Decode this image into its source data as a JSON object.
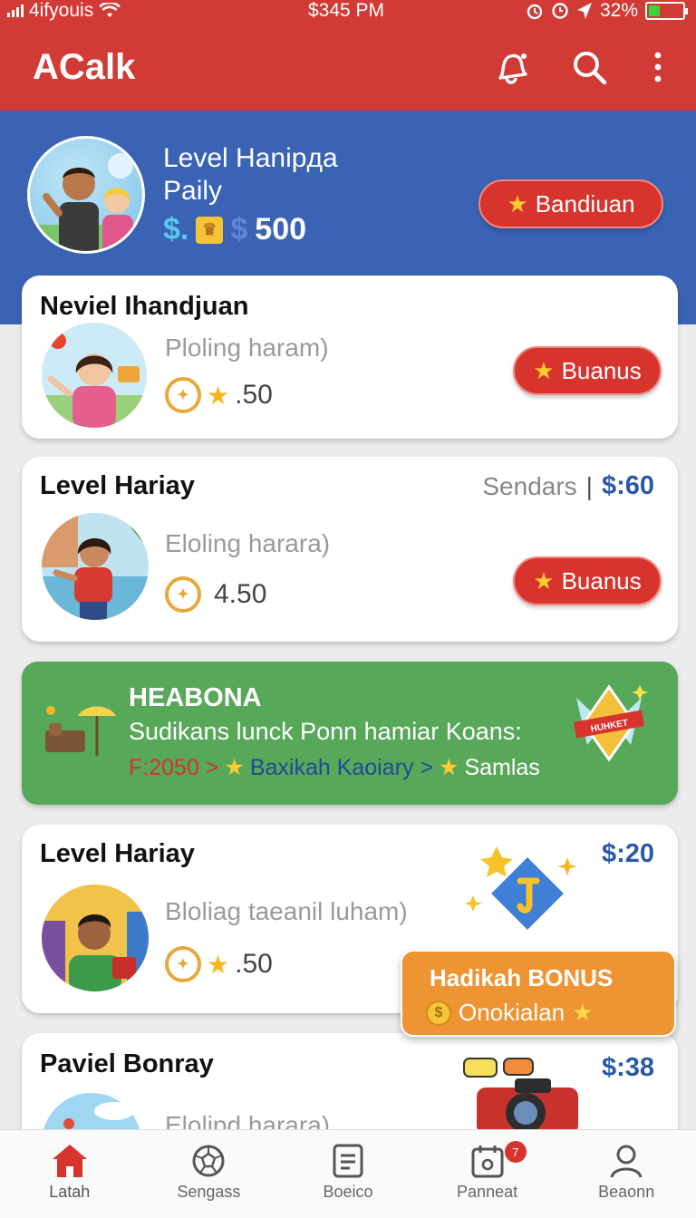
{
  "status_bar": {
    "carrier": "4ifyouis",
    "time": "$345 PM",
    "battery": "32%",
    "battery_level": 0.32
  },
  "app_bar": {
    "title": "ACalk",
    "icons": [
      "bell-icon",
      "search-icon",
      "more-vert-icon"
    ]
  },
  "hero": {
    "title": "Level Hanipдa",
    "subtitle": "Paily",
    "currency": "$.",
    "ghost_currency": "$",
    "amount": "500",
    "button_label": "Bandiuan"
  },
  "cards": [
    {
      "title": "Neviel Ihandjuan",
      "subtitle": "Ploling haram)",
      "stat": ".50",
      "button_label": "Buanus"
    },
    {
      "title": "Level Hariay",
      "subtitle": "Eloling harara)",
      "stat": "4.50",
      "sendars_label": "Sendars",
      "separator": "|",
      "price": "$:60",
      "button_label": "Buanus"
    },
    {
      "title": "Level Hariay",
      "subtitle": "Bloliag taeanil luham)",
      "stat": ".50",
      "price": "$:20"
    },
    {
      "title": "Paviel Bonray",
      "subtitle": "Eloliрd harara)",
      "price": "$:38"
    }
  ],
  "promo": {
    "title": "HEABONA",
    "text": "Sudikans lunck Ponn hamiar Koans:",
    "step1": "F:2050 >",
    "step2": "Baxikah Kaoiary >",
    "step3": "Samlas",
    "ribbon": "HUHKET"
  },
  "bonus_popup": {
    "title": "Hadikah BONUS",
    "subtitle": "Onokialan"
  },
  "bottom_nav": [
    {
      "label": "Latah",
      "icon": "home-icon"
    },
    {
      "label": "Sengass",
      "icon": "soccer-ball-icon"
    },
    {
      "label": "Boeico",
      "icon": "document-icon"
    },
    {
      "label": "Panneat",
      "icon": "calendar-icon",
      "badge": "7"
    },
    {
      "label": "Beaonn",
      "icon": "person-icon"
    }
  ],
  "colors": {
    "app_bar": "#d13a35",
    "hero": "#3a63b4",
    "button": "#d8342e",
    "promo": "#58a85a",
    "price": "#2859a8",
    "bonus": "#ee9432"
  }
}
